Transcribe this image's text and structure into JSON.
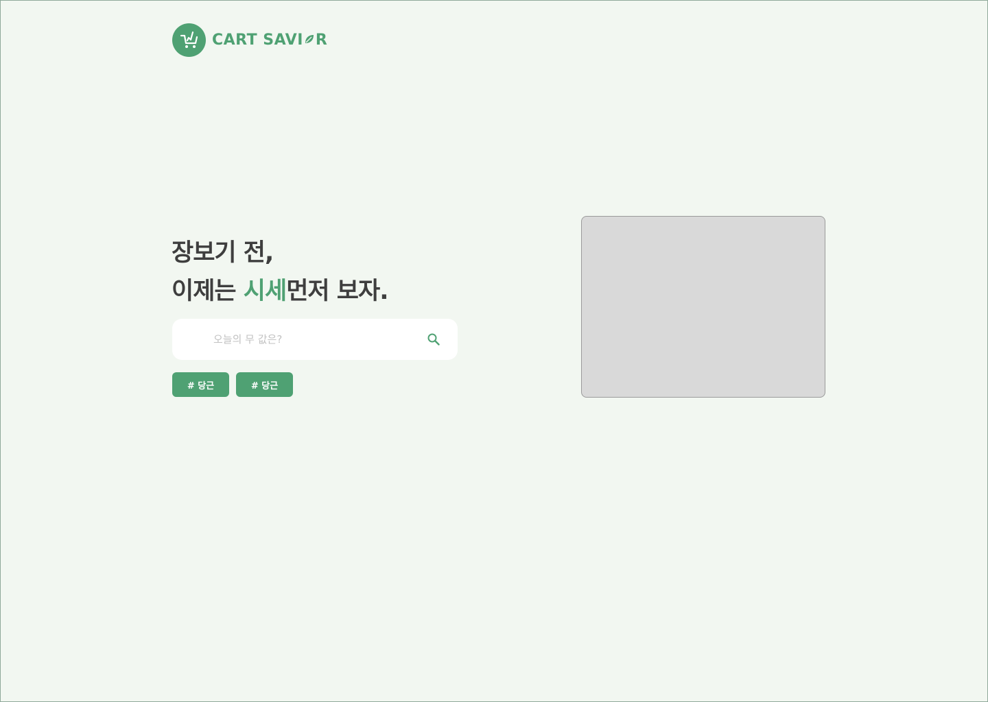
{
  "brand": {
    "name_part1": "CART SAVI",
    "name_part2": "R",
    "logo_icon": "shopping-cart-icon",
    "leaf_icon": "leaf-icon",
    "color": "#4fa173"
  },
  "hero": {
    "line1": "장보기 전,",
    "line2_prefix": "이제는 ",
    "line2_accent": "시세",
    "line2_suffix": "먼저 보자."
  },
  "search": {
    "placeholder": "오늘의 무 값은?",
    "value": "",
    "icon": "search-icon"
  },
  "tags": [
    {
      "label": "# 당근"
    },
    {
      "label": "# 당근"
    }
  ],
  "colors": {
    "background": "#f2f7f1",
    "accent": "#4fa173",
    "text": "#3e3e3e",
    "placeholder_box": "#d9d9d9"
  }
}
